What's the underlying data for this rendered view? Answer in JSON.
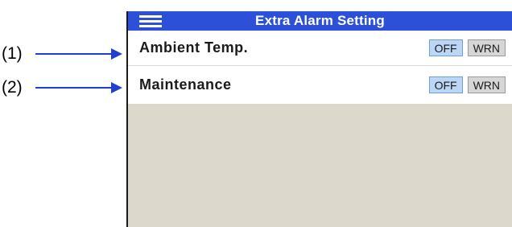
{
  "annotations": [
    {
      "label": "(1)"
    },
    {
      "label": "(2)"
    }
  ],
  "screen": {
    "title": "Extra Alarm Setting",
    "rows": [
      {
        "label": "Ambient Temp.",
        "options": [
          "OFF",
          "WRN"
        ],
        "selected": "OFF"
      },
      {
        "label": "Maintenance",
        "options": [
          "OFF",
          "WRN"
        ],
        "selected": "OFF"
      }
    ]
  },
  "colors": {
    "titlebar": "#2d50d8",
    "arrow": "#1f3fd0",
    "selected_button": "#bcd6f5",
    "unselected_button": "#d6d6d6",
    "empty_area": "#ddd8cc"
  },
  "icons": {
    "menu": "hamburger-menu-icon"
  }
}
